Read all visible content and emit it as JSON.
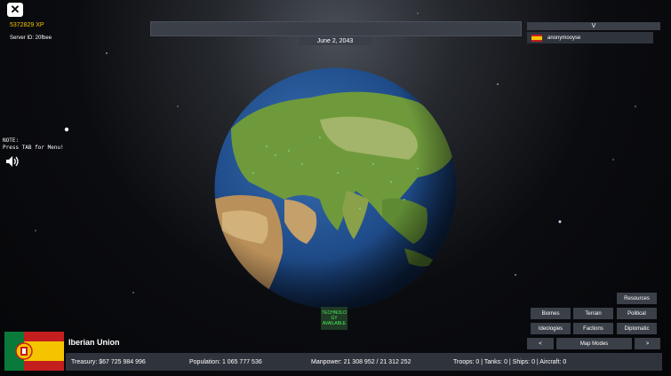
{
  "header": {
    "close_label": "✕",
    "xp": "5372829 XP",
    "server_id": "Server ID: 20fbee",
    "date": "June 2, 2043",
    "dropdown_label": "V"
  },
  "player": {
    "name": "anonymooyse"
  },
  "note": {
    "text": "NOTE:\nPress TAB for Menu!"
  },
  "technology": {
    "text": "TECHNOLO\nGY\nAVAILABLE"
  },
  "map_modes": {
    "resources": "Resources",
    "biomes": "Biomes",
    "terrain": "Terrain",
    "political": "Political",
    "ideologies": "Ideologies",
    "factions": "Factions",
    "diplomatic": "Diplomatic",
    "prev": "<",
    "label": "Map Modes",
    "next": ">"
  },
  "country": {
    "name": "Iberian Union",
    "treasury": "Treasury:  $67 725 984 996",
    "population": "Population: 1 065 777 536",
    "manpower": "Manpower:  21 308 952  /  21 312 252",
    "military": "Troops: 0  |  Tanks: 0  |  Ships: 0  |  Aircraft: 0"
  },
  "colors": {
    "panel": "#3a3f48",
    "xp": "#f5c400",
    "tech_text": "#4df05a",
    "flag_red": "#c41e1e",
    "flag_yellow": "#f5c400"
  }
}
